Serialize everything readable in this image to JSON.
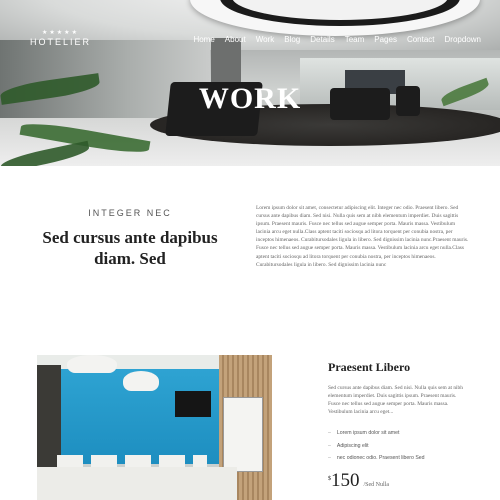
{
  "brand": {
    "stars": "★★★★★",
    "name": "HOTELIER"
  },
  "nav": [
    "Home",
    "About",
    "Work",
    "Blog",
    "Details",
    "Team",
    "Pages",
    "Contact",
    "Dropdown"
  ],
  "hero": {
    "title": "WORK"
  },
  "intro": {
    "kicker": "INTEGER NEC",
    "title": "Sed cursus ante dapibus diam. Sed",
    "body": "Lorem ipsum dolor sit amet, consectetur adipiscing elit. Integer nec odio. Praesent libero. Sed cursus ante dapibus diam. Sed nisi. Nulla quis sem at nibh elementum imperdiet. Duis sagittis ipsum. Praesent mauris. Fusce nec tellus sed augue semper porta. Mauris massa. Vestibulum lacinia arcu eget nulla.Class aptent taciti sociosqu ad litora torquent per conubia nostra, per inceptos himenaeos. Curabitursodales ligula in libero. Sed dignissim lacinia nunc.Praesent mauris. Fusce nec tellus sed augue semper porta. Mauris massa. Vestibulum lacinia arcu eget nulla.Class aptent taciti sociosqu ad litora torquent per conubia nostra, per inceptos himenaeos. Curabitursodales ligula in libero. Sed dignissim lacinia nunc"
  },
  "feature": {
    "title": "Praesent Libero",
    "description": "Sed cursus ante dapibus diam. Sed nisi. Nulla quis sem at nibh elementum imperdiet. Duis sagittis ipsum. Praesent mauris. Fusce nec tellus sed augue semper porta. Mauris massa. Vestibulum lacinia arcu eget...",
    "list": [
      "Lorem ipsum dolor sit amet",
      "Adipiscing elit",
      "nec odionec odio. Praesent libero Sed"
    ],
    "price": {
      "currency": "$",
      "amount": "150",
      "per": "/Sed Nulla"
    }
  }
}
